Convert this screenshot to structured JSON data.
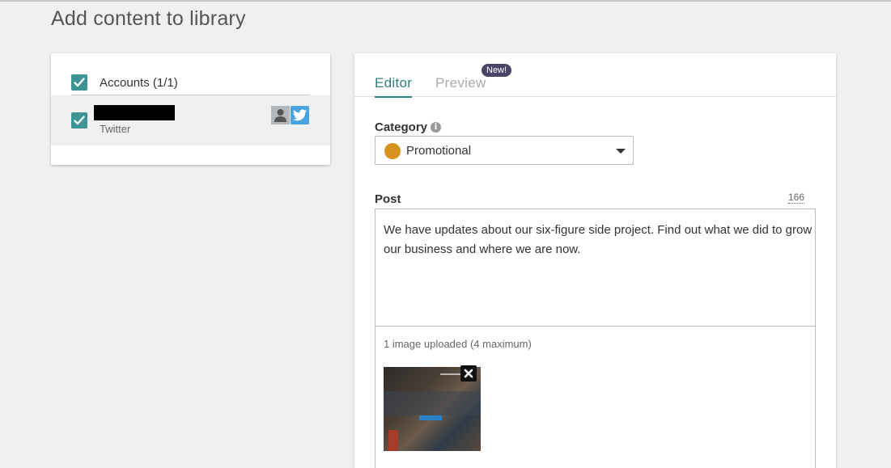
{
  "page": {
    "title": "Add content to library"
  },
  "accounts": {
    "header_label": "Accounts (1/1)",
    "items": [
      {
        "network": "Twitter",
        "checked": true,
        "name_redacted": true
      }
    ]
  },
  "editor": {
    "tabs": [
      {
        "label": "Editor",
        "active": true
      },
      {
        "label": "Preview",
        "active": false,
        "badge": "New!"
      }
    ],
    "category": {
      "label": "Category",
      "value": "Promotional",
      "color": "#d6921f"
    },
    "post": {
      "label": "Post",
      "char_count": "166",
      "text": "We have updates about our six-figure side project. Find out what we did to grow our business and where we are now.",
      "upload_info": "1 image uploaded (4 maximum)"
    }
  },
  "colors": {
    "accent": "#2f7f7f",
    "checkbox": "#3d9494",
    "twitter": "#4aa3df",
    "badge": "#4b4468"
  }
}
